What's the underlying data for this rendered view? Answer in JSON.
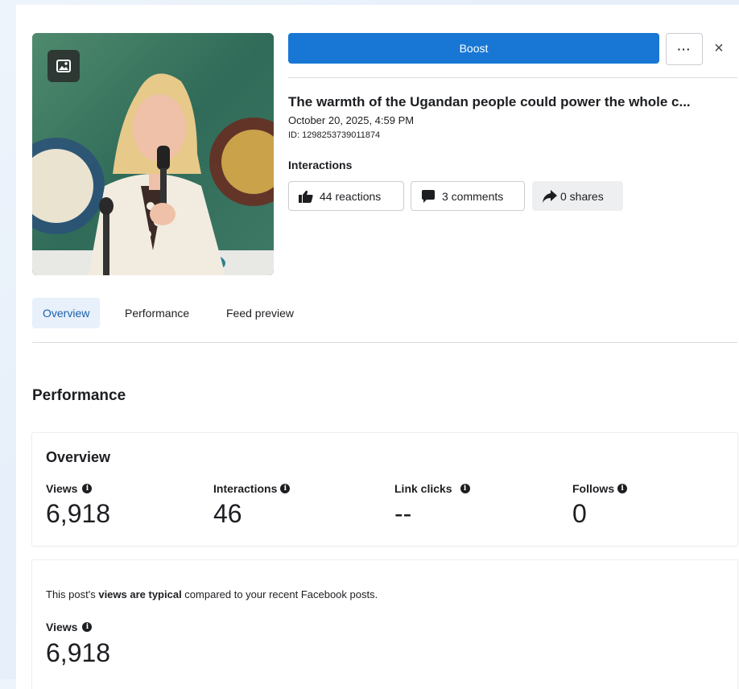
{
  "header": {
    "boost_label": "Boost",
    "more_label": "···",
    "close_label": "×"
  },
  "post": {
    "title": "The warmth of the Ugandan people could power the whole c...",
    "date": "October 20, 2025, 4:59 PM",
    "id": "ID: 1298253739011874",
    "interactions_label": "Interactions",
    "reactions": "44 reactions",
    "comments": "3 comments",
    "shares": "0 shares"
  },
  "tabs": [
    {
      "label": "Overview",
      "active": true
    },
    {
      "label": "Performance",
      "active": false
    },
    {
      "label": "Feed preview",
      "active": false
    }
  ],
  "performance": {
    "section_title": "Performance",
    "overview_title": "Overview",
    "metrics": [
      {
        "label": "Views",
        "value": "6,918"
      },
      {
        "label": "Interactions",
        "value": "46"
      },
      {
        "label": "Link clicks",
        "value": "--"
      },
      {
        "label": "Follows",
        "value": "0"
      }
    ],
    "typical": {
      "prefix": "This post's ",
      "bold": "views are typical",
      "suffix": " compared to your recent Facebook posts."
    },
    "views_label": "Views",
    "views_value": "6,918"
  },
  "icons": {
    "photo": "photo-icon",
    "reactions": "thumbs-up-icon",
    "comments": "comment-bubble-icon",
    "shares": "share-arrow-icon",
    "info": "info-icon"
  },
  "colors": {
    "accent": "#1877d4",
    "active_tab_bg": "#e7f0fb",
    "active_tab_text": "#1e5fa8"
  }
}
